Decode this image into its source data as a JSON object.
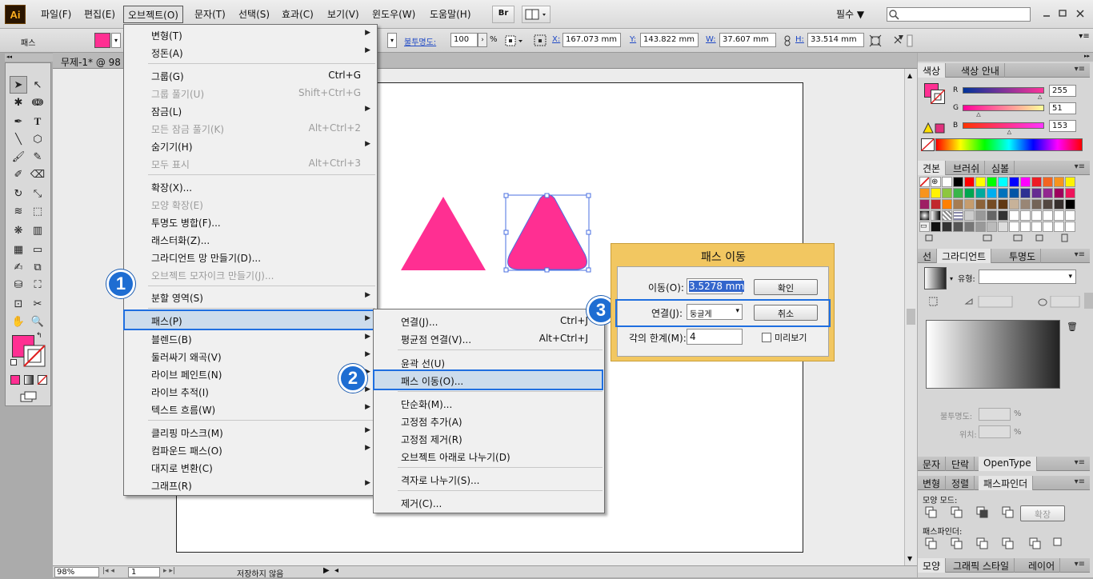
{
  "app": {
    "logo": "Ai"
  },
  "menubar": {
    "items": [
      "파일(F)",
      "편집(E)",
      "오브젝트(O)",
      "문자(T)",
      "선택(S)",
      "효과(C)",
      "보기(V)",
      "윈도우(W)",
      "도움말(H)"
    ],
    "bridge": "Br",
    "workspace": "필수 ▼",
    "window_controls": [
      "minimize-icon",
      "restore-icon",
      "close-icon"
    ]
  },
  "controlbar": {
    "object_type": "패스",
    "fill_color": "#ff2f92",
    "opacity_label": "불투명도:",
    "opacity_value": "100",
    "opacity_unit": "%",
    "x_label": "X:",
    "x_value": "167.073 mm",
    "y_label": "Y:",
    "y_value": "143.822 mm",
    "w_label": "W:",
    "w_value": "37.607 mm",
    "h_label": "H:",
    "h_value": "33.514 mm"
  },
  "document": {
    "tab_title": "무제-1* @ 98"
  },
  "status": {
    "zoom": "98%",
    "page": "1",
    "save_status": "저장하지 않음"
  },
  "object_menu": [
    {
      "label": "변형(T)",
      "arrow": true
    },
    {
      "label": "정돈(A)",
      "arrow": true
    },
    {
      "label": "그룹(G)",
      "shortcut": "Ctrl+G"
    },
    {
      "label": "그룹 풀기(U)",
      "shortcut": "Shift+Ctrl+G",
      "disabled": true
    },
    {
      "label": "잠금(L)",
      "arrow": true
    },
    {
      "label": "모든 잠금 풀기(K)",
      "shortcut": "Alt+Ctrl+2",
      "disabled": true
    },
    {
      "label": "숨기기(H)",
      "arrow": true
    },
    {
      "label": "모두 표시",
      "shortcut": "Alt+Ctrl+3",
      "disabled": true
    },
    {
      "label": "확장(X)..."
    },
    {
      "label": "모양 확장(E)",
      "disabled": true
    },
    {
      "label": "투명도 병합(F)..."
    },
    {
      "label": "래스터화(Z)..."
    },
    {
      "label": "그라디언트 망 만들기(D)..."
    },
    {
      "label": "오브젝트 모자이크 만들기(J)...",
      "disabled": true
    },
    {
      "label": "분할 영역(S)",
      "arrow": true
    },
    {
      "label": "패스(P)",
      "arrow": true,
      "highlight": true
    },
    {
      "label": "블렌드(B)",
      "arrow": true
    },
    {
      "label": "둘러싸기 왜곡(V)",
      "arrow": true
    },
    {
      "label": "라이브 페인트(N)",
      "arrow": true
    },
    {
      "label": "라이브 추적(I)",
      "arrow": true
    },
    {
      "label": "텍스트 흐름(W)",
      "arrow": true
    },
    {
      "label": "클리핑 마스크(M)",
      "arrow": true
    },
    {
      "label": "컴파운드 패스(O)",
      "arrow": true
    },
    {
      "label": "대지로 변환(C)"
    },
    {
      "label": "그래프(R)",
      "arrow": true
    }
  ],
  "path_submenu": [
    {
      "label": "연결(J)...",
      "shortcut": "Ctrl+J"
    },
    {
      "label": "평균점 연결(V)...",
      "shortcut": "Alt+Ctrl+J"
    },
    {
      "label": "윤곽 선(U)"
    },
    {
      "label": "패스 이동(O)...",
      "highlight": true
    },
    {
      "label": "단순화(M)..."
    },
    {
      "label": "고정점 추가(A)"
    },
    {
      "label": "고정점 제거(R)"
    },
    {
      "label": "오브젝트 아래로 나누기(D)"
    },
    {
      "label": "격자로 나누기(S)..."
    },
    {
      "label": "제거(C)..."
    }
  ],
  "badges": [
    "1",
    "2",
    "3"
  ],
  "offset_dialog": {
    "title": "패스 이동",
    "offset_label": "이동(O):",
    "offset_value": "3.5278 mm",
    "joins_label": "연결(J):",
    "joins_value": "둥글게",
    "miter_label": "각의 한계(M):",
    "miter_value": "4",
    "ok": "확인",
    "cancel": "취소",
    "preview": "미리보기"
  },
  "color_panel": {
    "tabs": [
      "색상",
      "색상 안내"
    ],
    "channels": [
      {
        "name": "R",
        "value": "255",
        "fraction": 1.0
      },
      {
        "name": "G",
        "value": "51",
        "fraction": 0.2
      },
      {
        "name": "B",
        "value": "153",
        "fraction": 0.6
      }
    ]
  },
  "swatch_panel": {
    "tabs": [
      "견본",
      "브러쉬",
      "심볼"
    ]
  },
  "gradient_panel": {
    "tabs": [
      "선",
      "그라디언트",
      "투명도"
    ],
    "type_label": "유형:",
    "opacity_label": "불투명도:",
    "location_label": "위치:",
    "percent": "%"
  },
  "type_panel": {
    "tabs": [
      "문자",
      "단락",
      "OpenType"
    ]
  },
  "pathfinder_panel": {
    "tabs": [
      "변형",
      "정렬",
      "패스파인더"
    ],
    "shape_modes_label": "모양 모드:",
    "expand_button": "확장",
    "pathfinders_label": "패스파인더:"
  },
  "bottom_panel": {
    "tabs": [
      "모양",
      "그래픽 스타일",
      "레이어"
    ]
  },
  "colors": {
    "pink": "#ff2f92",
    "selection": "#4a6fe0",
    "accent_blue": "#1e6dd2",
    "dialog_frame": "#f2c761"
  }
}
